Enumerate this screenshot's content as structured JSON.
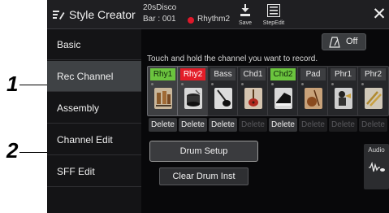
{
  "callouts": [
    "1",
    "2"
  ],
  "titlebar": {
    "app_title": "Style Creator",
    "style_name": "20sDisco",
    "bar_info": "Bar : 001",
    "rec_part": "Rhythm2",
    "save_label": "Save",
    "stepedit_label": "StepEdit",
    "close_label": "✕"
  },
  "sidebar": {
    "items": [
      {
        "label": "Basic"
      },
      {
        "label": "Rec Channel"
      },
      {
        "label": "Assembly"
      },
      {
        "label": "Channel Edit"
      },
      {
        "label": "SFF Edit"
      }
    ],
    "active": "Rec Channel"
  },
  "main": {
    "off_label": "Off",
    "instruction": "Touch and hold the channel you want to record.",
    "channels": [
      {
        "label": "Rhy1",
        "state": "green",
        "icon": "drum-kit-icon",
        "delete": "Delete",
        "delete_enabled": true
      },
      {
        "label": "Rhy2",
        "state": "red",
        "icon": "percussion-icon",
        "delete": "Delete",
        "delete_enabled": true
      },
      {
        "label": "Bass",
        "state": "none",
        "icon": "bass-guitar-icon",
        "delete": "Delete",
        "delete_enabled": true
      },
      {
        "label": "Chd1",
        "state": "none",
        "icon": "guitar-icon",
        "delete": "Delete",
        "delete_enabled": false
      },
      {
        "label": "Chd2",
        "state": "green",
        "icon": "piano-icon",
        "delete": "Delete",
        "delete_enabled": true
      },
      {
        "label": "Pad",
        "state": "none",
        "icon": "strings-icon",
        "delete": "Delete",
        "delete_enabled": false
      },
      {
        "label": "Phr1",
        "state": "none",
        "icon": "trumpet-player-icon",
        "delete": "Delete",
        "delete_enabled": false
      },
      {
        "label": "Phr2",
        "state": "none",
        "icon": "horns-icon",
        "delete": "Delete",
        "delete_enabled": false
      }
    ],
    "drum_setup_label": "Drum Setup",
    "clear_drum_label": "Clear Drum Inst",
    "audio_label": "Audio"
  },
  "colors": {
    "green": "#6bc43e",
    "red": "#e31d28",
    "rec_dot": "#e0182a",
    "active_sidebar": "#3f4245"
  }
}
